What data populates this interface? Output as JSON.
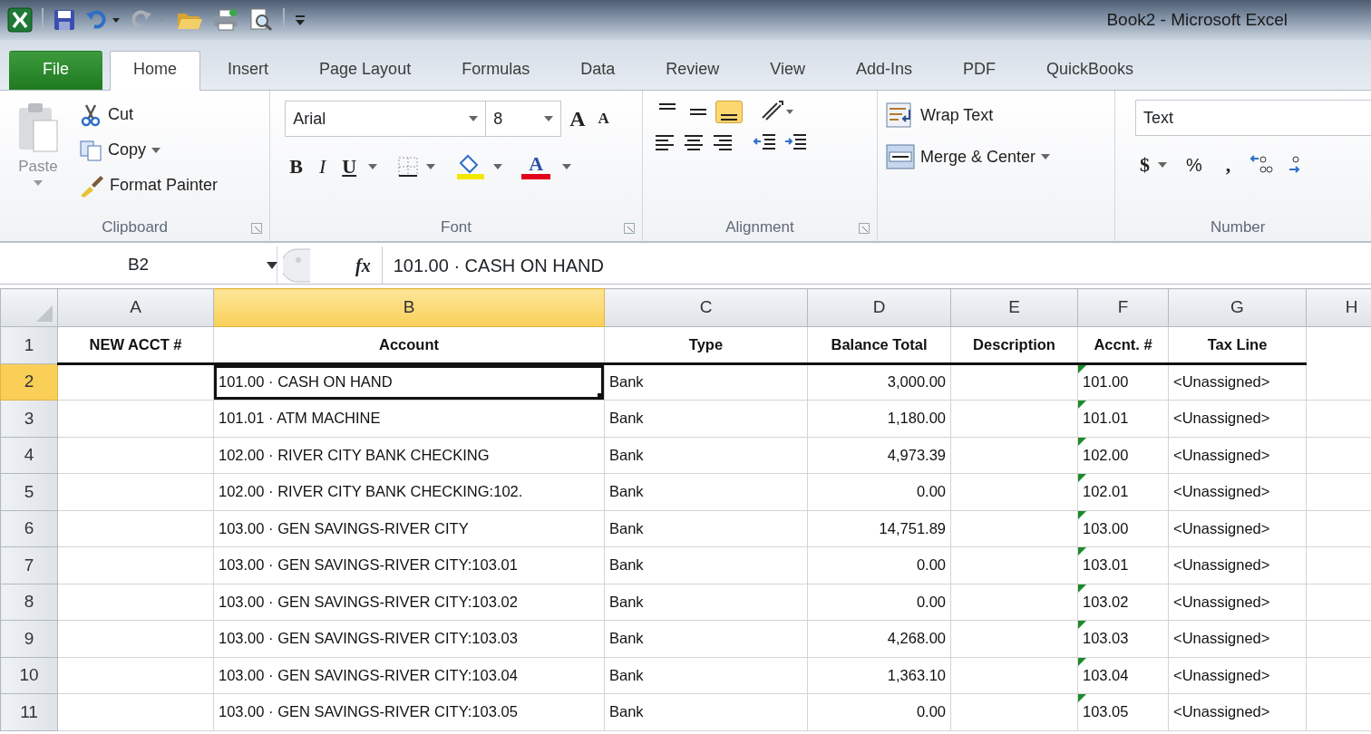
{
  "window": {
    "title": "Book2  -  Microsoft Excel"
  },
  "tabs": [
    {
      "label": "File",
      "kind": "file",
      "selected": false
    },
    {
      "label": "Home",
      "kind": "tab",
      "selected": true
    },
    {
      "label": "Insert",
      "kind": "tab",
      "selected": false
    },
    {
      "label": "Page Layout",
      "kind": "tab",
      "selected": false
    },
    {
      "label": "Formulas",
      "kind": "tab",
      "selected": false
    },
    {
      "label": "Data",
      "kind": "tab",
      "selected": false
    },
    {
      "label": "Review",
      "kind": "tab",
      "selected": false
    },
    {
      "label": "View",
      "kind": "tab",
      "selected": false
    },
    {
      "label": "Add-Ins",
      "kind": "tab",
      "selected": false
    },
    {
      "label": "PDF",
      "kind": "tab",
      "selected": false
    },
    {
      "label": "QuickBooks",
      "kind": "tab",
      "selected": false
    }
  ],
  "ribbon": {
    "clipboard": {
      "paste": "Paste",
      "cut": "Cut",
      "copy": "Copy",
      "format_painter": "Format Painter",
      "label": "Clipboard"
    },
    "font": {
      "name": "Arial",
      "size": "8",
      "grow": "A",
      "shrink": "A",
      "bold": "B",
      "italic": "I",
      "underline": "U",
      "font_color": "A",
      "label": "Font"
    },
    "alignment": {
      "vertical": [
        {
          "selected": false
        },
        {
          "selected": false
        },
        {
          "selected": true
        }
      ],
      "wrap_text": "Wrap Text",
      "merge": "Merge & Center",
      "label": "Alignment"
    },
    "number": {
      "format": "Text",
      "currency": "$",
      "percent": "%",
      "comma": ",",
      "label": "Number"
    }
  },
  "formula_bar": {
    "name_box": "B2",
    "function_symbol": "fx",
    "formula": "101.00 · CASH ON HAND"
  },
  "sheet": {
    "columns": [
      {
        "label": "A",
        "selected": false
      },
      {
        "label": "B",
        "selected": true
      },
      {
        "label": "C",
        "selected": false
      },
      {
        "label": "D",
        "selected": false
      },
      {
        "label": "E",
        "selected": false
      },
      {
        "label": "F",
        "selected": false
      },
      {
        "label": "G",
        "selected": false
      },
      {
        "label": "H",
        "selected": false
      }
    ],
    "header_row": {
      "row": "1",
      "cells": [
        "NEW ACCT #",
        "Account",
        "Type",
        "Balance Total",
        "Description",
        "Accnt. #",
        "Tax Line"
      ]
    },
    "rows": [
      {
        "row": "2",
        "selected": true,
        "account": "101.00 · CASH ON HAND",
        "type": "Bank",
        "balance": "3,000.00",
        "accnt": "101.00",
        "flagged": true,
        "tax_line": "<Unassigned>"
      },
      {
        "row": "3",
        "selected": false,
        "account": "101.01 · ATM MACHINE",
        "type": "Bank",
        "balance": "1,180.00",
        "accnt": "101.01",
        "flagged": true,
        "tax_line": "<Unassigned>"
      },
      {
        "row": "4",
        "selected": false,
        "account": "102.00 · RIVER CITY BANK CHECKING",
        "type": "Bank",
        "balance": "4,973.39",
        "accnt": "102.00",
        "flagged": true,
        "tax_line": "<Unassigned>"
      },
      {
        "row": "5",
        "selected": false,
        "account": "102.00 · RIVER CITY BANK CHECKING:102.",
        "type": "Bank",
        "balance": "0.00",
        "accnt": "102.01",
        "flagged": true,
        "tax_line": "<Unassigned>"
      },
      {
        "row": "6",
        "selected": false,
        "account": "103.00 · GEN SAVINGS-RIVER CITY",
        "type": "Bank",
        "balance": "14,751.89",
        "accnt": "103.00",
        "flagged": true,
        "tax_line": "<Unassigned>"
      },
      {
        "row": "7",
        "selected": false,
        "account": "103.00 · GEN SAVINGS-RIVER CITY:103.01",
        "type": "Bank",
        "balance": "0.00",
        "accnt": "103.01",
        "flagged": true,
        "tax_line": "<Unassigned>"
      },
      {
        "row": "8",
        "selected": false,
        "account": "103.00 · GEN SAVINGS-RIVER CITY:103.02",
        "type": "Bank",
        "balance": "0.00",
        "accnt": "103.02",
        "flagged": true,
        "tax_line": "<Unassigned>"
      },
      {
        "row": "9",
        "selected": false,
        "account": "103.00 · GEN SAVINGS-RIVER CITY:103.03",
        "type": "Bank",
        "balance": "4,268.00",
        "accnt": "103.03",
        "flagged": true,
        "tax_line": "<Unassigned>"
      },
      {
        "row": "10",
        "selected": false,
        "account": "103.00 · GEN SAVINGS-RIVER CITY:103.04",
        "type": "Bank",
        "balance": "1,363.10",
        "accnt": "103.04",
        "flagged": true,
        "tax_line": "<Unassigned>"
      },
      {
        "row": "11",
        "selected": false,
        "account": "103.00 · GEN SAVINGS-RIVER CITY:103.05",
        "type": "Bank",
        "balance": "0.00",
        "accnt": "103.05",
        "flagged": true,
        "tax_line": "<Unassigned>"
      }
    ]
  }
}
